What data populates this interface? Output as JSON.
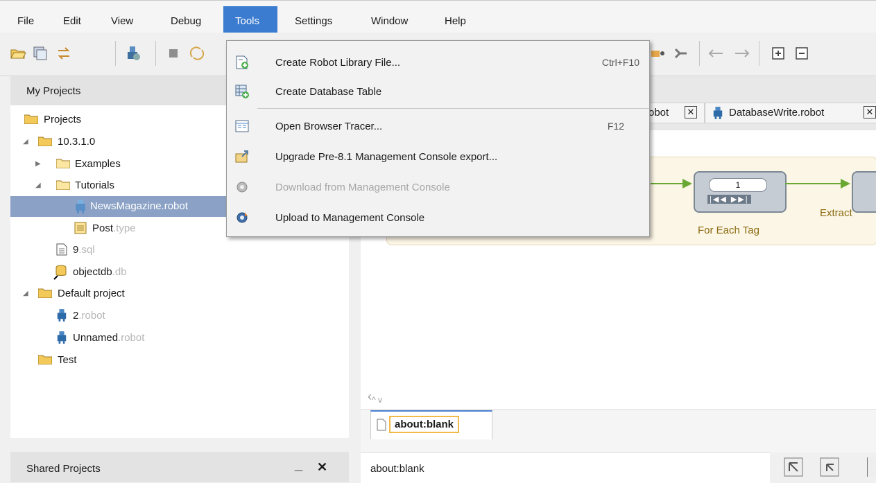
{
  "menubar": {
    "items": [
      {
        "label": "File"
      },
      {
        "label": "Edit"
      },
      {
        "label": "View"
      },
      {
        "label": "Debug"
      },
      {
        "label": "Tools"
      },
      {
        "label": "Settings"
      },
      {
        "label": "Window"
      },
      {
        "label": "Help"
      }
    ]
  },
  "tools_menu": {
    "items": [
      {
        "label": "Create Robot Library File...",
        "shortcut": "Ctrl+F10"
      },
      {
        "label": "Create Database Table"
      },
      {
        "label": "Open Browser Tracer...",
        "shortcut": "F12"
      },
      {
        "label": "Upgrade Pre-8.1 Management Console export..."
      },
      {
        "label": "Download from Management Console",
        "disabled": true
      },
      {
        "label": "Upload to Management Console"
      }
    ]
  },
  "left_panel": {
    "title": "My Projects",
    "tree": {
      "projects": "Projects",
      "version": "10.3.1.0",
      "examples": "Examples",
      "tutorials": "Tutorials",
      "news_name": "NewsMagazine.robot",
      "post_name": "Post",
      "post_ext": ".type",
      "sql_name": "9",
      "sql_ext": ".sql",
      "db_name": "objectdb",
      "db_ext": ".db",
      "default_project": "Default project",
      "robot2_name": "2",
      "robot2_ext": ".robot",
      "unnamed_name": "Unnamed",
      "unnamed_ext": ".robot",
      "test": "Test"
    }
  },
  "shared_panel": {
    "title": "Shared Projects",
    "minimize": "_",
    "close": "✕"
  },
  "editor": {
    "tabs": [
      {
        "label": "obot"
      },
      {
        "label": "DatabaseWrite.robot"
      }
    ],
    "flow": {
      "loop_counter": "1",
      "step_label": "For Each Tag",
      "next_step_label": "Extract"
    }
  },
  "browser": {
    "tab_label": "about:blank",
    "address": "about:blank"
  },
  "colors": {
    "menu_highlight": "#3b7bd0",
    "tree_selection": "#8ba2c6",
    "flow_arrow": "#69a832"
  }
}
